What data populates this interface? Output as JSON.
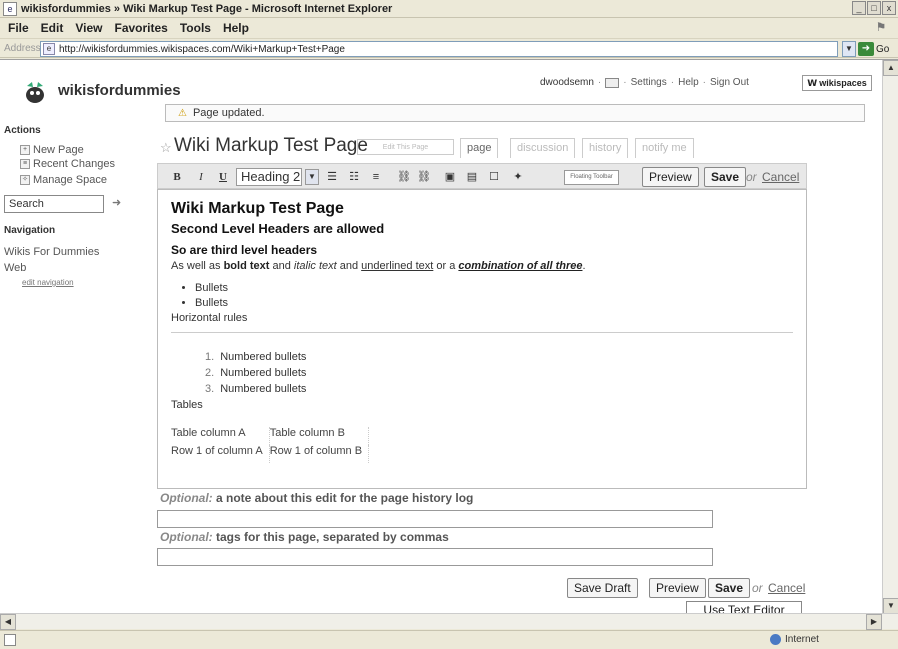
{
  "window": {
    "title": "wikisfordummies » Wiki Markup Test Page - Microsoft Internet Explorer",
    "buttons": [
      "_",
      "□",
      "x"
    ]
  },
  "menu": [
    "File",
    "Edit",
    "View",
    "Favorites",
    "Tools",
    "Help"
  ],
  "address": {
    "label": "Address",
    "url": "http://wikisfordummies.wikispaces.com/Wiki+Markup+Test+Page",
    "go": "Go"
  },
  "wiki": {
    "site_name": "wikisfordummies",
    "user": "dwoodsemn",
    "links": [
      "Settings",
      "Help",
      "Sign Out"
    ],
    "badge": "wikispaces"
  },
  "notice": "Page updated.",
  "sidebar": {
    "actions_heading": "Actions",
    "actions": [
      "New Page",
      "Recent Changes",
      "Manage Space"
    ],
    "search_value": "Search",
    "navigation_heading": "Navigation",
    "nav_items": [
      "Wikis For Dummies",
      "Web"
    ],
    "edit_navigation": "edit navigation"
  },
  "page": {
    "title": "Wiki Markup Test Page",
    "edit_button": "Edit This Page",
    "tabs": [
      "page",
      "discussion",
      "history",
      "notify me"
    ]
  },
  "toolbar": {
    "bold": "B",
    "italic": "I",
    "underline": "U",
    "heading_value": "Heading 2",
    "floating_toolbar": "Floating Toolbar",
    "preview": "Preview",
    "save": "Save",
    "or": "or",
    "cancel": "Cancel"
  },
  "editor": {
    "h1": "Wiki Markup Test Page",
    "h2": "Second Level Headers are allowed",
    "h3": "So are third level headers",
    "p_start": "As well as ",
    "p_bold": "bold text",
    "p_and1": " and ",
    "p_italic": "italic text",
    "p_and2": " and ",
    "p_underline": "underlined text",
    "p_or": " or a ",
    "p_combo": "combination of all three",
    "p_end": ".",
    "bullets": [
      "Bullets",
      "Bullets"
    ],
    "hr_label": "Horizontal rules",
    "numbered": [
      "Numbered bullets",
      "Numbered bullets",
      "Numbered bullets"
    ],
    "tables_label": "Tables",
    "table_rows": [
      [
        "Table column A",
        "Table column B"
      ],
      [
        "Row 1 of column A",
        "Row 1 of column B"
      ]
    ]
  },
  "form": {
    "note_optional": "Optional:",
    "note_label": " a note about this edit for the page history log",
    "tags_optional": "Optional:",
    "tags_label": " tags for this page, separated by commas",
    "save_draft": "Save Draft",
    "preview": "Preview",
    "save": "Save",
    "or": "or",
    "cancel": "Cancel",
    "use_text_editor": "Use Text Editor"
  },
  "status": {
    "zone": "Internet"
  }
}
